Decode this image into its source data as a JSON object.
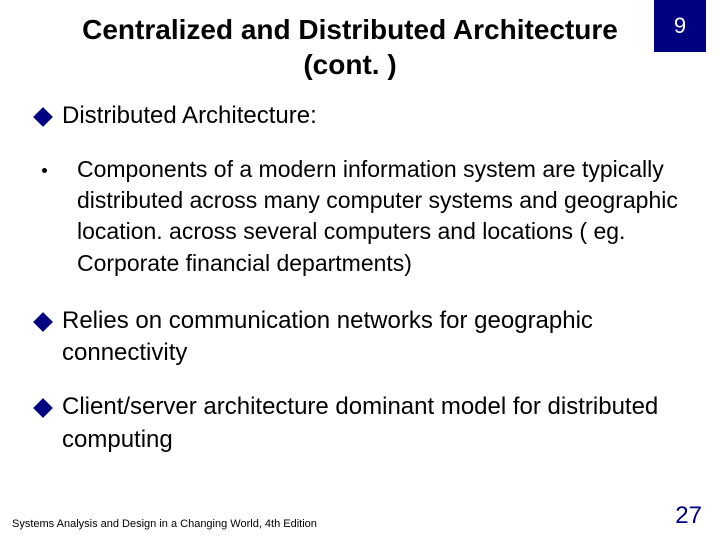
{
  "badge": {
    "chapter": "9"
  },
  "title": "Centralized and Distributed Architecture (cont. )",
  "bullets": {
    "b1": "Distributed Architecture:",
    "sub1": "Components of a modern information system are typically distributed across many computer systems and geographic location. across several computers and locations ( eg. Corporate financial departments)",
    "b2": "Relies on communication networks for geographic connectivity",
    "b3": "Client/server architecture dominant model for distributed computing"
  },
  "footer": {
    "source": "Systems Analysis and Design in a Changing World, 4th Edition",
    "page": "27"
  }
}
